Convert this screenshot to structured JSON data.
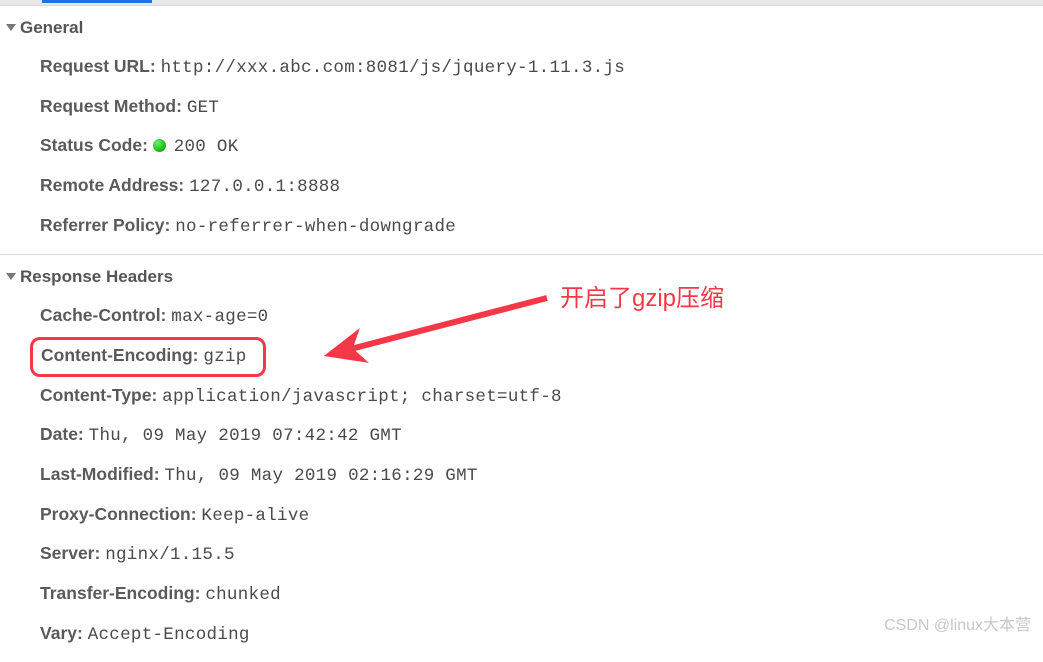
{
  "sections": {
    "general": {
      "title": "General",
      "request_url": {
        "label": "Request URL:",
        "value": "http://xxx.abc.com:8081/js/jquery-1.11.3.js"
      },
      "request_method": {
        "label": "Request Method:",
        "value": "GET"
      },
      "status_code": {
        "label": "Status Code:",
        "value": "200 OK"
      },
      "remote_address": {
        "label": "Remote Address:",
        "value": "127.0.0.1:8888"
      },
      "referrer_policy": {
        "label": "Referrer Policy:",
        "value": "no-referrer-when-downgrade"
      }
    },
    "response_headers": {
      "title": "Response Headers",
      "cache_control": {
        "label": "Cache-Control:",
        "value": "max-age=0"
      },
      "content_encoding": {
        "label": "Content-Encoding:",
        "value": "gzip"
      },
      "content_type": {
        "label": "Content-Type:",
        "value": "application/javascript; charset=utf-8"
      },
      "date": {
        "label": "Date:",
        "value": "Thu, 09 May 2019 07:42:42 GMT"
      },
      "last_modified": {
        "label": "Last-Modified:",
        "value": "Thu, 09 May 2019 02:16:29 GMT"
      },
      "proxy_connection": {
        "label": "Proxy-Connection:",
        "value": "Keep-alive"
      },
      "server": {
        "label": "Server:",
        "value": "nginx/1.15.5"
      },
      "transfer_encoding": {
        "label": "Transfer-Encoding:",
        "value": "chunked"
      },
      "vary": {
        "label": "Vary:",
        "value": "Accept-Encoding"
      }
    }
  },
  "annotation": {
    "text": "开启了gzip压缩",
    "color": "#f43848"
  },
  "watermark": "CSDN @linux大本营"
}
